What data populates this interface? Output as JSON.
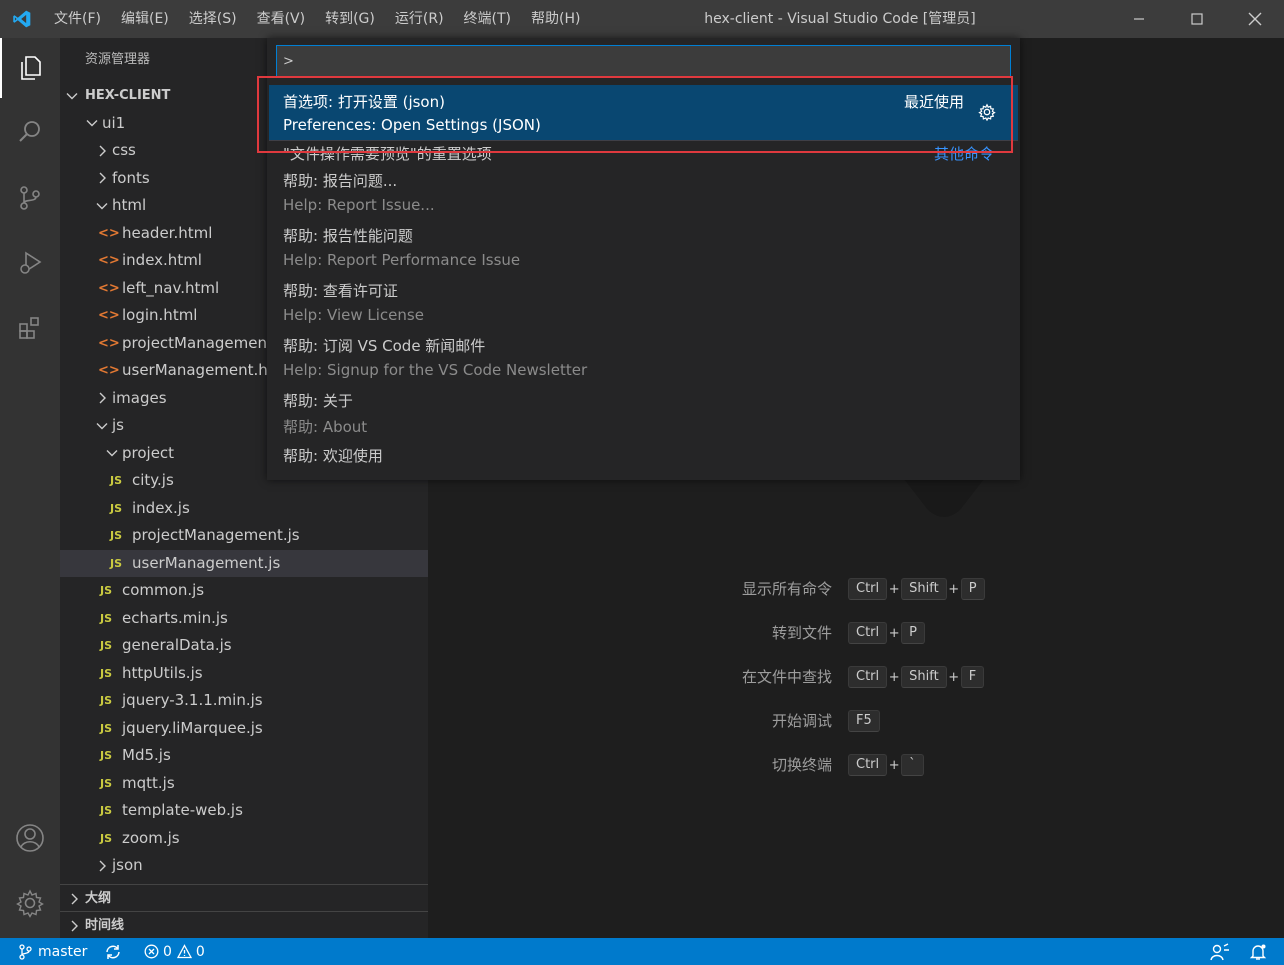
{
  "window": {
    "title": "hex-client - Visual Studio Code [管理员]"
  },
  "menu": [
    "文件(F)",
    "编辑(E)",
    "选择(S)",
    "查看(V)",
    "转到(G)",
    "运行(R)",
    "终端(T)",
    "帮助(H)"
  ],
  "sidebar": {
    "title": "资源管理器",
    "root": "HEX-CLIENT",
    "tree": [
      {
        "label": "ui1",
        "type": "folder",
        "open": true,
        "depth": 1
      },
      {
        "label": "css",
        "type": "folder",
        "open": false,
        "depth": 2
      },
      {
        "label": "fonts",
        "type": "folder",
        "open": false,
        "depth": 2
      },
      {
        "label": "html",
        "type": "folder",
        "open": true,
        "depth": 2
      },
      {
        "label": "header.html",
        "type": "html",
        "depth": 3
      },
      {
        "label": "index.html",
        "type": "html",
        "depth": 3
      },
      {
        "label": "left_nav.html",
        "type": "html",
        "depth": 3
      },
      {
        "label": "login.html",
        "type": "html",
        "depth": 3
      },
      {
        "label": "projectManagement.html",
        "type": "html",
        "depth": 3
      },
      {
        "label": "userManagement.html",
        "type": "html",
        "depth": 3
      },
      {
        "label": "images",
        "type": "folder",
        "open": false,
        "depth": 2
      },
      {
        "label": "js",
        "type": "folder",
        "open": true,
        "depth": 2
      },
      {
        "label": "project",
        "type": "folder",
        "open": true,
        "depth": 3
      },
      {
        "label": "city.js",
        "type": "js",
        "depth": 4
      },
      {
        "label": "index.js",
        "type": "js",
        "depth": 4
      },
      {
        "label": "projectManagement.js",
        "type": "js",
        "depth": 4
      },
      {
        "label": "userManagement.js",
        "type": "js",
        "depth": 4,
        "selected": true
      },
      {
        "label": "common.js",
        "type": "js",
        "depth": 3
      },
      {
        "label": "echarts.min.js",
        "type": "js",
        "depth": 3
      },
      {
        "label": "generalData.js",
        "type": "js",
        "depth": 3
      },
      {
        "label": "httpUtils.js",
        "type": "js",
        "depth": 3
      },
      {
        "label": "jquery-3.1.1.min.js",
        "type": "js",
        "depth": 3
      },
      {
        "label": "jquery.liMarquee.js",
        "type": "js",
        "depth": 3
      },
      {
        "label": "Md5.js",
        "type": "js",
        "depth": 3
      },
      {
        "label": "mqtt.js",
        "type": "js",
        "depth": 3
      },
      {
        "label": "template-web.js",
        "type": "js",
        "depth": 3
      },
      {
        "label": "zoom.js",
        "type": "js",
        "depth": 3
      },
      {
        "label": "json",
        "type": "folder",
        "open": false,
        "depth": 2
      }
    ],
    "file_icon_js": "JS",
    "file_icon_html": "<>",
    "outline": "大纲",
    "timeline": "时间线"
  },
  "palette": {
    "input_value": ">",
    "commands": [
      {
        "main": "首选项: 打开设置 (json)",
        "alt": "Preferences: Open Settings (JSON)",
        "right": "最近使用",
        "selected": true,
        "gear": true
      },
      {
        "main": "\"文件操作需要预览\"的重置选项",
        "alt": "",
        "right": "其他命令",
        "link": true
      },
      {
        "main": "帮助: 报告问题...",
        "alt": "Help: Report Issue..."
      },
      {
        "main": "帮助: 报告性能问题",
        "alt": "Help: Report Performance Issue"
      },
      {
        "main": "帮助: 查看许可证",
        "alt": "Help: View License"
      },
      {
        "main": "帮助: 订阅 VS Code 新闻邮件",
        "alt": "Help: Signup for the VS Code Newsletter"
      },
      {
        "main": "帮助: 关于",
        "alt": "帮助: About"
      },
      {
        "main": "帮助: 欢迎使用",
        "alt": ""
      }
    ]
  },
  "shortcuts": [
    {
      "label": "显示所有命令",
      "keys": [
        "Ctrl",
        "Shift",
        "P"
      ]
    },
    {
      "label": "转到文件",
      "keys": [
        "Ctrl",
        "P"
      ]
    },
    {
      "label": "在文件中查找",
      "keys": [
        "Ctrl",
        "Shift",
        "F"
      ]
    },
    {
      "label": "开始调试",
      "keys": [
        "F5"
      ]
    },
    {
      "label": "切换终端",
      "keys": [
        "Ctrl",
        "`"
      ]
    }
  ],
  "statusbar": {
    "branch": "master",
    "errors": "0",
    "warnings": "0"
  },
  "colors": {
    "accent": "#007acc",
    "selection": "#094771",
    "highlight": "#e0393e"
  }
}
